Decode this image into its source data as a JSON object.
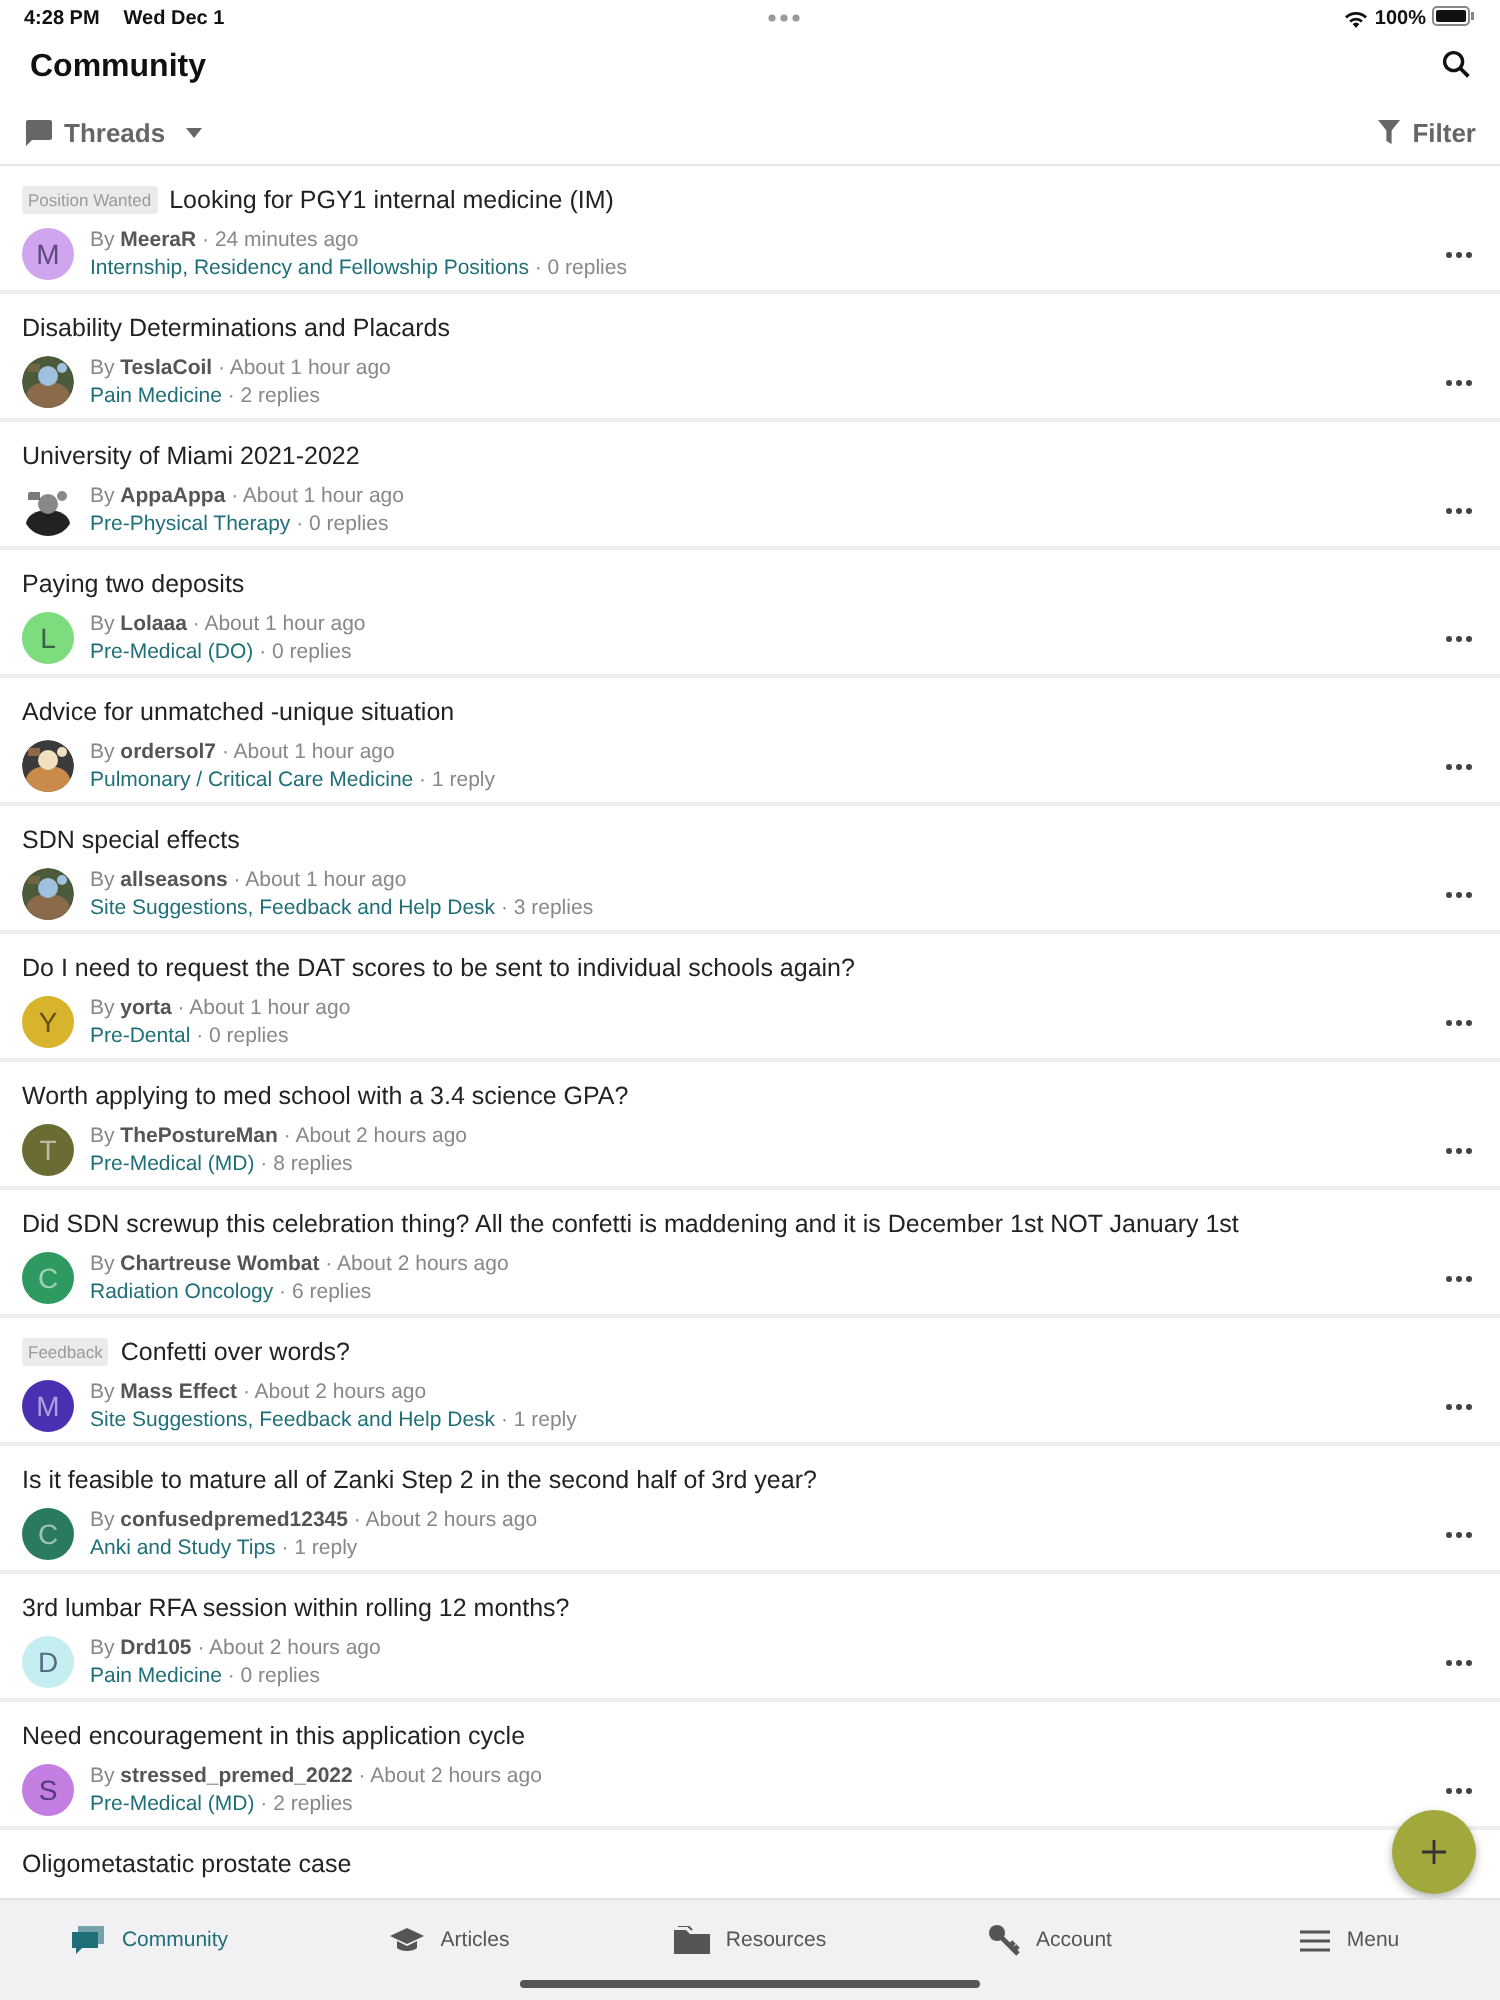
{
  "status_bar": {
    "time": "4:28 PM",
    "date": "Wed Dec 1",
    "battery": "100%"
  },
  "header": {
    "title": "Community"
  },
  "toolbar": {
    "view": "Threads",
    "filter": "Filter"
  },
  "threads": [
    {
      "tag": "Position Wanted",
      "title": "Looking for PGY1 internal medicine (IM)",
      "avatar": {
        "kind": "letter",
        "letter": "M",
        "color": "#cfa6ee"
      },
      "byline": "By **MeeraR** · 24 minutes ago",
      "category": "Internship, Residency and Fellowship Positions",
      "replies": "· 0 replies"
    },
    {
      "title": "Disability Determinations and Placards",
      "byline": "By **TeslaCoil** · About 1 hour ago",
      "category": "Pain Medicine",
      "replies": "· 2 replies"
    },
    {
      "title": "University of Miami 2021-2022",
      "byline": "By **AppaAppa** · About 1 hour ago",
      "category": "Pre-Physical Therapy",
      "replies": "· 0 replies"
    },
    {
      "title": "Paying two deposits",
      "avatar": {
        "kind": "letter",
        "letter": "L",
        "color": "#7ddc7d"
      },
      "byline": "By **Lolaaa** · About 1 hour ago",
      "category": "Pre-Medical (DO)",
      "replies": "· 0 replies"
    },
    {
      "title": "Advice for unmatched -unique situation",
      "byline": "By **ordersol7** · About 1 hour ago",
      "category": "Pulmonary / Critical Care Medicine",
      "replies": "· 1 reply"
    },
    {
      "title": "SDN special effects",
      "byline": "By **allseasons** · About 1 hour ago",
      "category": "Site Suggestions, Feedback and Help Desk",
      "replies": "· 3 replies"
    },
    {
      "title": "Do I need to request the DAT scores to be sent to individual schools again?",
      "avatar": {
        "kind": "letter",
        "letter": "Y",
        "color": "#d8b42c"
      },
      "byline": "By **yorta** · About 1 hour ago",
      "category": "Pre-Dental",
      "replies": "· 0 replies"
    },
    {
      "title": "Worth applying to med school with a 3.4 science GPA?",
      "avatar": {
        "kind": "letter",
        "letter": "T",
        "color": "#6b6b34"
      },
      "byline": "By **ThePostureMan** · About 2 hours ago",
      "category": "Pre-Medical (MD)",
      "replies": "· 8 replies"
    },
    {
      "title": "Did SDN screwup this celebration thing? All the confetti is maddening and it is December 1st NOT January 1st",
      "avatar": {
        "kind": "letter",
        "letter": "C",
        "color": "#2e9a62"
      },
      "byline": "By **Chartreuse Wombat** · About 2 hours ago",
      "category": "Radiation Oncology",
      "replies": "· 6 replies"
    },
    {
      "tag": "Feedback",
      "title": "Confetti over words?",
      "avatar": {
        "kind": "letter",
        "letter": "M",
        "color": "#4a2fb0"
      },
      "byline": "By **Mass Effect** · About 2 hours ago",
      "category": "Site Suggestions, Feedback and Help Desk",
      "replies": "· 1 reply"
    },
    {
      "title": "Is it feasible to mature all of Zanki Step 2 in the second half of 3rd year?",
      "avatar": {
        "kind": "letter",
        "letter": "C",
        "color": "#2a7a5e"
      },
      "byline": "By **confusedpremed12345** · About 2 hours ago",
      "category": "Anki and Study Tips",
      "replies": "· 1 reply"
    },
    {
      "title": "3rd lumbar RFA session within rolling 12 months?",
      "avatar": {
        "kind": "letter",
        "letter": "D",
        "color": "#c4eef0"
      },
      "byline": "By **Drd105** · About 2 hours ago",
      "category": "Pain Medicine",
      "replies": "· 0 replies"
    },
    {
      "title": "Need encouragement in this application cycle",
      "avatar": {
        "kind": "letter",
        "letter": "S",
        "color": "#c27ee0"
      },
      "byline": "By **stressed_premed_2022** · About 2 hours ago",
      "category": "Pre-Medical (MD)",
      "replies": "· 2 replies"
    },
    {
      "title": "Oligometastatic prostate case"
    }
  ],
  "tab_bar": [
    {
      "label": "Community",
      "selected": true
    },
    {
      "label": "Articles",
      "selected": false
    },
    {
      "label": "Resources",
      "selected": false
    },
    {
      "label": "Account",
      "selected": false
    },
    {
      "label": "Menu",
      "selected": false
    }
  ]
}
